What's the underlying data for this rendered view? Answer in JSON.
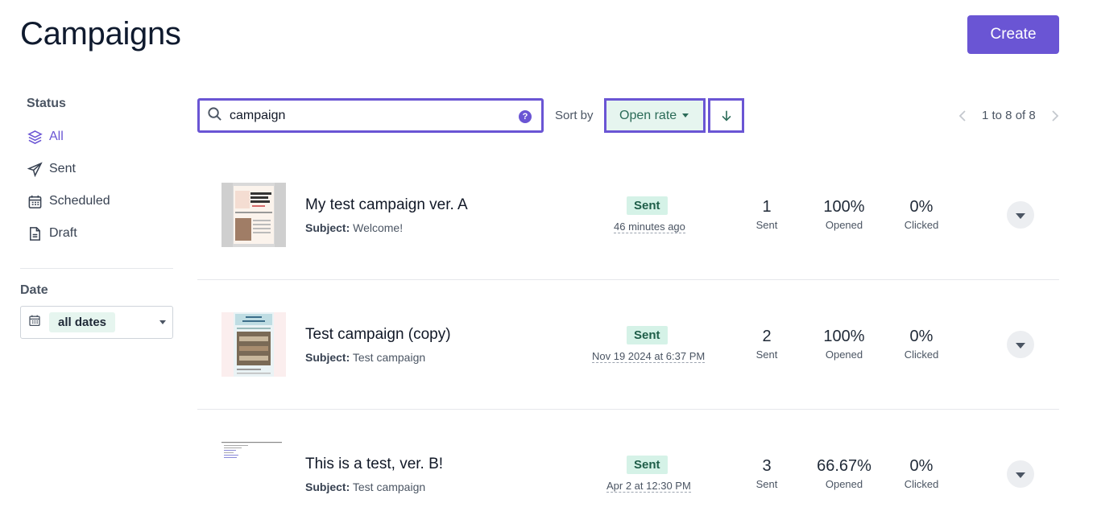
{
  "header": {
    "title": "Campaigns",
    "create_label": "Create"
  },
  "sidebar": {
    "status_heading": "Status",
    "items": [
      {
        "label": "All",
        "icon": "layers-icon",
        "active": true
      },
      {
        "label": "Sent",
        "icon": "send-icon",
        "active": false
      },
      {
        "label": "Scheduled",
        "icon": "calendar-icon",
        "active": false
      },
      {
        "label": "Draft",
        "icon": "document-icon",
        "active": false
      }
    ],
    "date_heading": "Date",
    "date_value": "all dates"
  },
  "toolbar": {
    "search_value": "campaign",
    "help_glyph": "?",
    "sort_label": "Sort by",
    "sort_value": "Open rate",
    "sort_direction": "descending",
    "pagination": "1 to 8 of 8"
  },
  "colors": {
    "accent": "#6a55d4",
    "badge_bg": "#d5f2e7",
    "badge_text": "#1f5e49"
  },
  "campaigns": [
    {
      "name": "My test campaign ver. A",
      "subject_label": "Subject:",
      "subject": "Welcome!",
      "status": "Sent",
      "date": "46 minutes ago",
      "sent": "1",
      "sent_label": "Sent",
      "opened": "100%",
      "opened_label": "Opened",
      "clicked": "0%",
      "clicked_label": "Clicked"
    },
    {
      "name": "Test campaign (copy)",
      "subject_label": "Subject:",
      "subject": "Test campaign",
      "status": "Sent",
      "date": "Nov 19 2024 at 6:37 PM",
      "sent": "2",
      "sent_label": "Sent",
      "opened": "100%",
      "opened_label": "Opened",
      "clicked": "0%",
      "clicked_label": "Clicked"
    },
    {
      "name": "This is a test, ver. B!",
      "subject_label": "Subject:",
      "subject": "Test campaign",
      "status": "Sent",
      "date": "Apr 2 at 12:30 PM",
      "sent": "3",
      "sent_label": "Sent",
      "opened": "66.67%",
      "opened_label": "Opened",
      "clicked": "0%",
      "clicked_label": "Clicked"
    }
  ]
}
